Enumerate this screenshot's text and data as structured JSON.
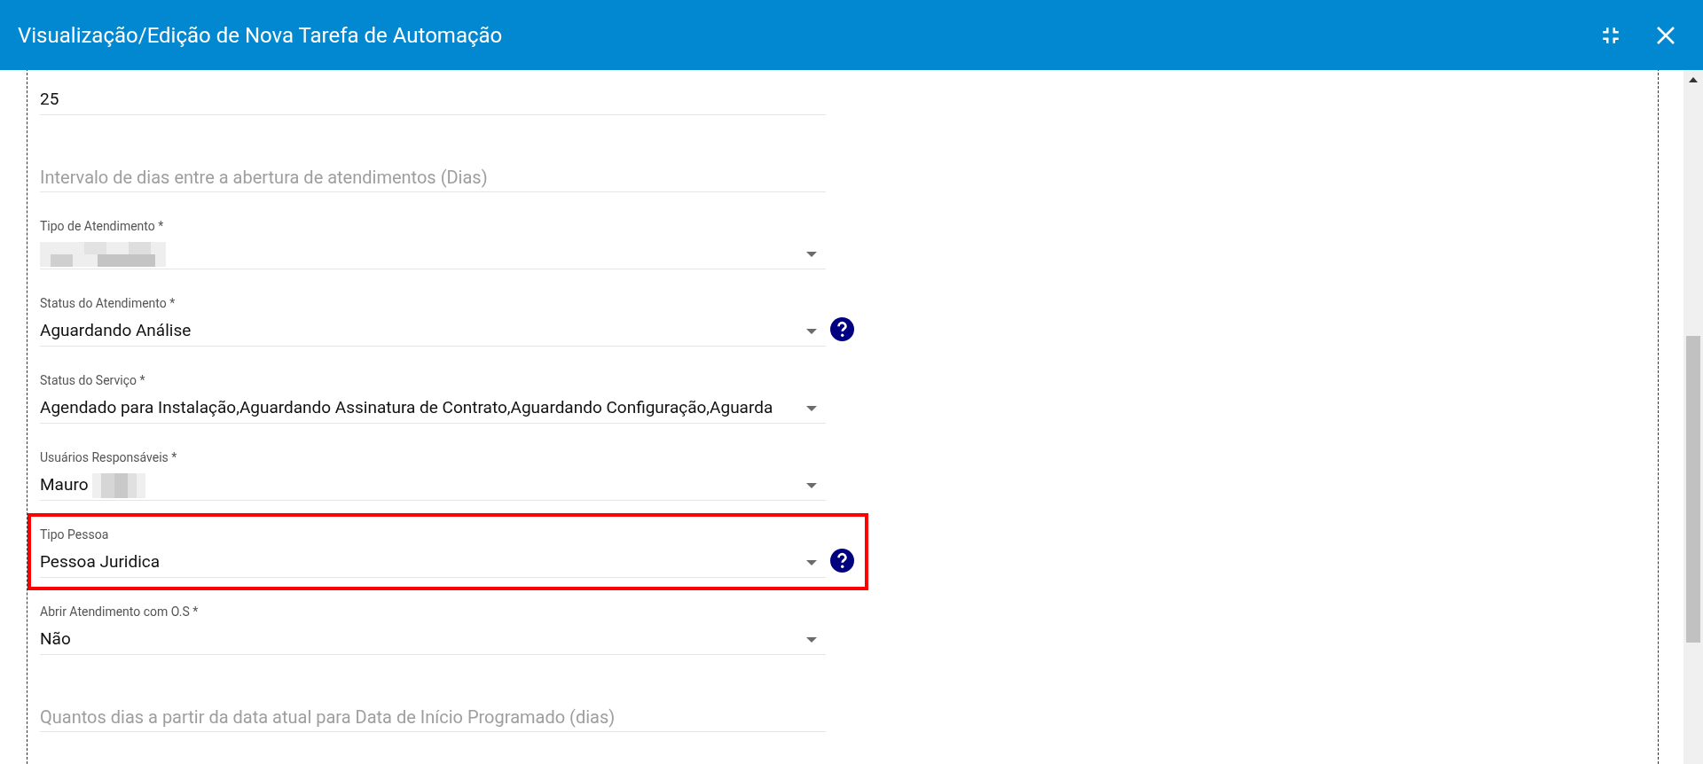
{
  "window": {
    "title": "Visualização/Edição de Nova Tarefa de Automação"
  },
  "fields": [
    {
      "kind": "input",
      "value": "25",
      "help": false,
      "highlighted": false,
      "redacted": false
    },
    {
      "kind": "placeholder",
      "placeholder": "Intervalo de dias entre a abertura de atendimentos (Dias)",
      "help": false,
      "highlighted": false,
      "redacted": false
    },
    {
      "kind": "select",
      "label": "Tipo de Atendimento *",
      "help": false,
      "highlighted": false,
      "redacted": true
    },
    {
      "kind": "select",
      "label": "Status do Atendimento *",
      "value": "Aguardando Análise",
      "help": true,
      "highlighted": false,
      "redacted": false
    },
    {
      "kind": "select",
      "label": "Status do Serviço *",
      "value": "Agendado para Instalação,Aguardando Assinatura de Contrato,Aguardando Configuração,Aguarda",
      "help": false,
      "highlighted": false,
      "redacted": false
    },
    {
      "kind": "select",
      "label": "Usuários Responsáveis *",
      "value": "Mauro",
      "help": false,
      "highlighted": false,
      "redacted": true
    },
    {
      "kind": "select",
      "label": "Tipo Pessoa",
      "value": "Pessoa Juridica",
      "help": true,
      "highlighted": true,
      "redacted": false
    },
    {
      "kind": "select",
      "label": "Abrir Atendimento com O.S *",
      "value": "Não",
      "help": false,
      "highlighted": false,
      "redacted": false
    },
    {
      "kind": "placeholder",
      "placeholder": "Quantos dias a partir da data atual para Data de Início Programado (dias)",
      "help": false,
      "highlighted": false,
      "redacted": false
    }
  ]
}
